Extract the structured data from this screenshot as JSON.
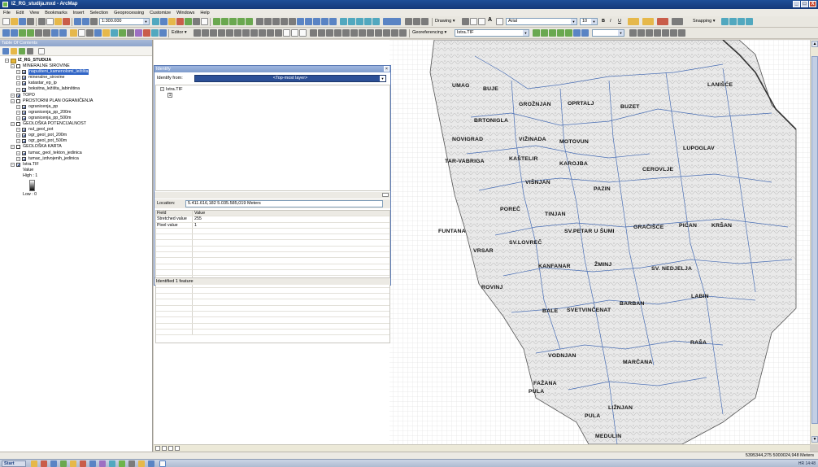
{
  "window": {
    "title": "IZ_RG_studija.mxd - ArcMap",
    "controls": [
      "_",
      "□",
      "X"
    ]
  },
  "menu": [
    "File",
    "Edit",
    "View",
    "Bookmarks",
    "Insert",
    "Selection",
    "Geoprocessing",
    "Customize",
    "Windows",
    "Help"
  ],
  "toolbar": {
    "scale": "1:300.000",
    "drawing_label": "Drawing ▾",
    "font_name": "Arial",
    "font_size": "10",
    "bold": "B",
    "italic": "I",
    "underline": "U",
    "snapping_label": "Snapping ▾",
    "editor_label": "Editor ▾",
    "georef_label": "Georeferencing ▾",
    "georef_layer": "Istra.TIF",
    "text_a": "A"
  },
  "toc": {
    "title": "Table Of Contents",
    "items": [
      {
        "label": "IZ_RG_STUDIJA",
        "level": 0,
        "type": "frame"
      },
      {
        "label": "MINERALNE SIROVINE",
        "level": 1,
        "checked": false
      },
      {
        "label": "napušteni_kamenolomi_ležišta",
        "level": 2,
        "checked": true,
        "selected": true
      },
      {
        "label": "mineralne_sirovine",
        "level": 2,
        "checked": true
      },
      {
        "label": "katastar_ep_ip",
        "level": 2,
        "checked": true
      },
      {
        "label": "boksitna_ležišta_labinština",
        "level": 2,
        "checked": true
      },
      {
        "label": "TOPO",
        "level": 1,
        "checked": true
      },
      {
        "label": "PROSTORNI PLAN OGRANIČENJA",
        "level": 1,
        "checked": false
      },
      {
        "label": "ogranicenja_pp",
        "level": 2,
        "checked": true
      },
      {
        "label": "ogranicenja_pp_200m",
        "level": 2,
        "checked": true
      },
      {
        "label": "ogranicenja_pp_500m",
        "level": 2,
        "checked": true
      },
      {
        "label": "GEOLOŠKA POTENCIJALNOST",
        "level": 1,
        "checked": false
      },
      {
        "label": "nul_geol_pot",
        "level": 2,
        "checked": true
      },
      {
        "label": "ogr_geol_pot_200m",
        "level": 2,
        "checked": true
      },
      {
        "label": "ogr_geol_pot_500m",
        "level": 2,
        "checked": true
      },
      {
        "label": "GEOLOŠKA KARTA",
        "level": 1,
        "checked": false
      },
      {
        "label": "tumac_geol_tekton_jedinica",
        "level": 2,
        "checked": true
      },
      {
        "label": "tumac_izdvojenih_jedinica",
        "level": 2,
        "checked": true
      },
      {
        "label": "Istra.TIF",
        "level": 1,
        "checked": true
      }
    ],
    "legend": {
      "title": "Value",
      "high": "High : 1",
      "low": "Low : 0"
    }
  },
  "identify": {
    "title": "Identify",
    "from_label": "Identify from:",
    "from_value": "<Top-most layer>",
    "tree_root": "Istra.TIF",
    "tree_leaf": "1",
    "location_label": "Location:",
    "location_value": "5.411.616,182  5.035.585,019 Meters",
    "columns": [
      "Field",
      "Value"
    ],
    "rows": [
      {
        "field": "Stretched value",
        "value": "255"
      },
      {
        "field": "Pixel value",
        "value": "1"
      }
    ],
    "status": "Identified 1 feature"
  },
  "map_labels": [
    "UMAG",
    "BUJE",
    "LANIŠĆE",
    "GROŽNJAN",
    "OPRTALJ",
    "BUZET",
    "BRTONIGLA",
    "NOVIGRAD",
    "VIŽINADA",
    "MOTOVUN",
    "LUPOGLAV",
    "TAR-VABRIGA",
    "KAŠTELIR",
    "KAROJBA",
    "CEROVLJE",
    "VIŠNJAN",
    "PAZIN",
    "POREČ",
    "TINJAN",
    "FUNTANA",
    "SV.PETAR U ŠUMI",
    "GRAČIŠĆE",
    "PIĆAN",
    "KRŠAN",
    "SV.LOVREČ",
    "VRSAR",
    "KANFANAR",
    "ŽMINJ",
    "SV. NEDJELJA",
    "ROVINJ",
    "BARBAN",
    "LABIN",
    "BALE",
    "SVETVINČENAT",
    "RAŠA",
    "VODNJAN",
    "MARČANA",
    "FAŽANA",
    "PULA",
    "PULA",
    "LIŽNJAN",
    "MEDULIN"
  ],
  "status": {
    "coordinates": "5395344,275  5000024,948 Meters"
  },
  "taskbar": {
    "start": "Start",
    "tray": "HR  14:48"
  }
}
